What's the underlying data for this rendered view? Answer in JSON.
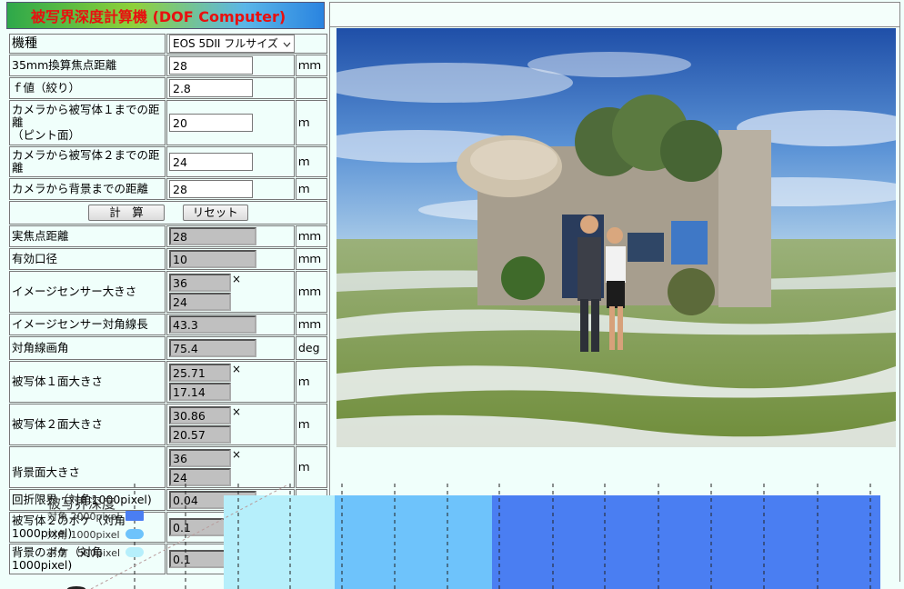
{
  "app": {
    "title": "被写界深度計算機 (DOF Computer)"
  },
  "inputs": {
    "camera": {
      "label": "機種",
      "value": "EOS 5DII フルサイズ"
    },
    "focal_35mm": {
      "label": "35mm換算焦点距離",
      "value": "28",
      "unit": "ｍｍ"
    },
    "fnumber": {
      "label": "ｆ値（絞り）",
      "value": "2.8",
      "unit": ""
    },
    "subject1": {
      "label": "カメラから被写体１までの距離\n（ピント面）",
      "value": "20",
      "unit": "ｍ"
    },
    "subject2": {
      "label": "カメラから被写体２までの距離",
      "value": "24",
      "unit": "ｍ"
    },
    "background": {
      "label": "カメラから背景までの距離",
      "value": "28",
      "unit": "ｍ"
    }
  },
  "buttons": {
    "compute": "計　算",
    "reset": "リセット"
  },
  "results": {
    "real_focal": {
      "label": "実焦点距離",
      "value": "28",
      "unit": "ｍｍ"
    },
    "aperture": {
      "label": "有効口径",
      "value": "10",
      "unit": "ｍｍ"
    },
    "sensor": {
      "label": "イメージセンサー大きさ",
      "w": "36",
      "h": "24",
      "times": "×",
      "unit": "ｍｍ"
    },
    "sensor_diag": {
      "label": "イメージセンサー対角線長",
      "value": "43.3",
      "unit": "ｍｍ"
    },
    "diag_angle": {
      "label": "対角線画角",
      "value": "75.4",
      "unit": "deg"
    },
    "plane1": {
      "label": "被写体１面大きさ",
      "w": "25.71",
      "h": "17.14",
      "times": "×",
      "unit": "ｍ"
    },
    "plane2": {
      "label": "被写体２面大きさ",
      "w": "30.86",
      "h": "20.57",
      "times": "×",
      "unit": "ｍ"
    },
    "bg_plane": {
      "label": "背景面大きさ",
      "w": "36",
      "h": "24",
      "times": "×",
      "unit": "ｍ"
    },
    "diffraction": {
      "label": "回折限界（対角1000pixel)",
      "value": "0.04"
    },
    "blur2": {
      "label": "被写体２のボケ（対角1000pixel)",
      "value": "0.1"
    },
    "blur_bg": {
      "label": "背景のボケ（対角1000pixel)",
      "value": "0.1"
    }
  },
  "chart_data": {
    "type": "bar",
    "title": "被写界深度",
    "series": [
      {
        "name": "対角 2000pixel",
        "color": "#4a7ef2"
      },
      {
        "name": "対角 1000pixel",
        "color": "#6ec3fb"
      },
      {
        "name": "対角　500pixel",
        "color": "#b6effb"
      }
    ]
  }
}
